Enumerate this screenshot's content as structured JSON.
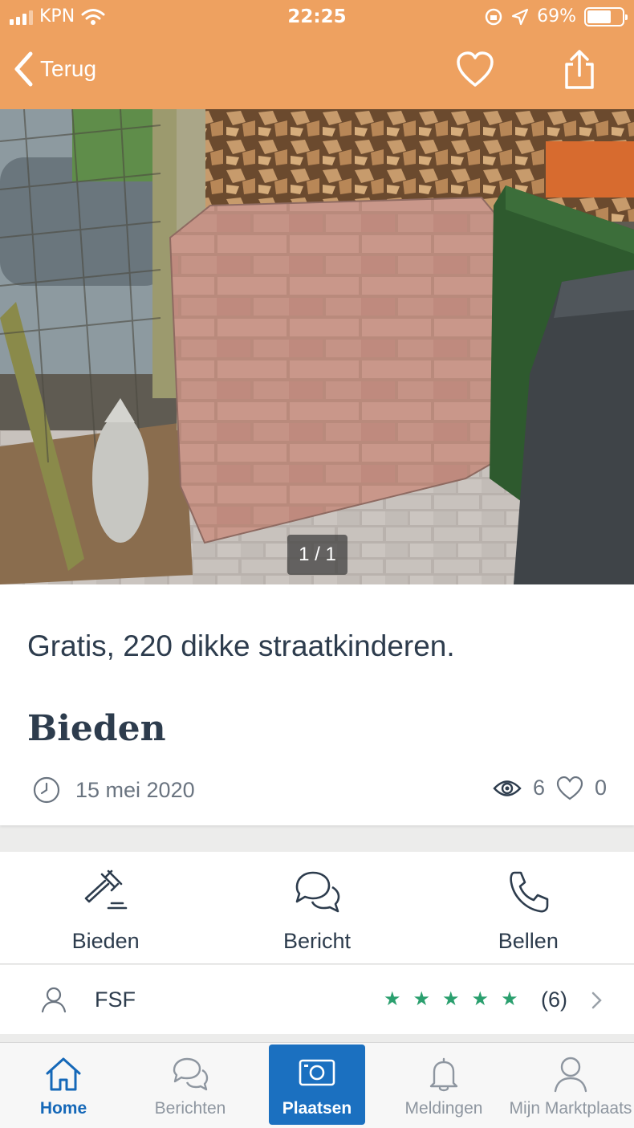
{
  "status_bar": {
    "carrier": "KPN",
    "time": "22:25",
    "battery": "69%",
    "battery_level": 0.69
  },
  "nav": {
    "back_label": "Terug",
    "favorite_icon": "heart-icon",
    "share_icon": "share-icon"
  },
  "photo": {
    "counter": "1 / 1"
  },
  "listing": {
    "title": "Gratis, 220 dikke straatkinderen.",
    "price": "Bieden",
    "date": "15 mei 2020",
    "views": "6",
    "favorites": "0"
  },
  "actions": [
    {
      "label": "Bieden",
      "icon": "gavel-icon"
    },
    {
      "label": "Bericht",
      "icon": "chat-icon"
    },
    {
      "label": "Bellen",
      "icon": "phone-icon"
    }
  ],
  "seller": {
    "name": "FSF",
    "rating_stars": 5,
    "rating_count": "(6)"
  },
  "tabs": [
    {
      "label": "Home",
      "icon": "home-icon",
      "active": true
    },
    {
      "label": "Berichten",
      "icon": "chat-icon"
    },
    {
      "label": "Plaatsen",
      "icon": "camera-icon",
      "primary": true
    },
    {
      "label": "Meldingen",
      "icon": "bell-icon"
    },
    {
      "label": "Mijn Marktplaats",
      "icon": "user-icon"
    }
  ],
  "colors": {
    "header": "#eea160",
    "accent": "#1b70c0",
    "star": "#2a9f6e",
    "text": "#2d3c4d"
  }
}
